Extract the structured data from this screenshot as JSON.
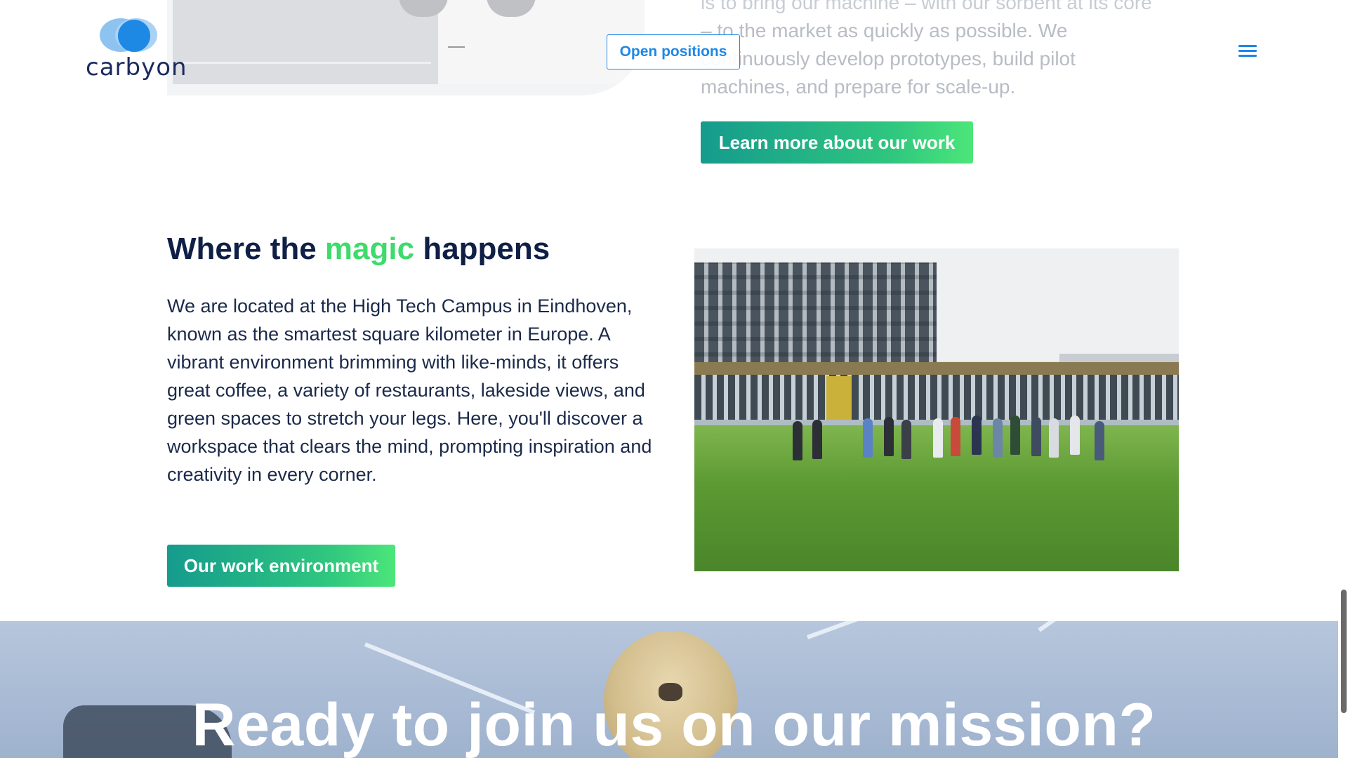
{
  "brand": {
    "logo_text": "carbyon",
    "colors": {
      "blue": "#1e88e5",
      "navy": "#0f1f45",
      "green": "#3ddb6b",
      "gradient_start": "#159b8d",
      "gradient_end": "#4ce67a"
    }
  },
  "header": {
    "open_positions_label": "Open positions",
    "menu_icon": "hamburger-menu-icon"
  },
  "top_section": {
    "paragraph_lines": [
      "is to bring our machine – with our sorbent at its core",
      "– to the market as quickly as possible. We",
      "continuously develop prototypes, build pilot",
      "machines, and prepare for scale-up."
    ],
    "learn_more_label": "Learn more about our work"
  },
  "environment_section": {
    "heading_before": "Where the ",
    "heading_accent": "magic",
    "heading_after": " happens",
    "paragraph": "We are located at the High Tech Campus in Eindhoven, known as the smartest square kilometer in Europe. A vibrant environment brimming with like-minds, it offers great coffee, a variety of restaurants, lakeside views, and green spaces to stretch your legs. Here, you'll discover a workspace that clears the mind, prompting inspiration and creativity in every corner.",
    "button_label": "Our work environment"
  },
  "cta_banner": {
    "title": "Ready to join us on our mission?"
  }
}
